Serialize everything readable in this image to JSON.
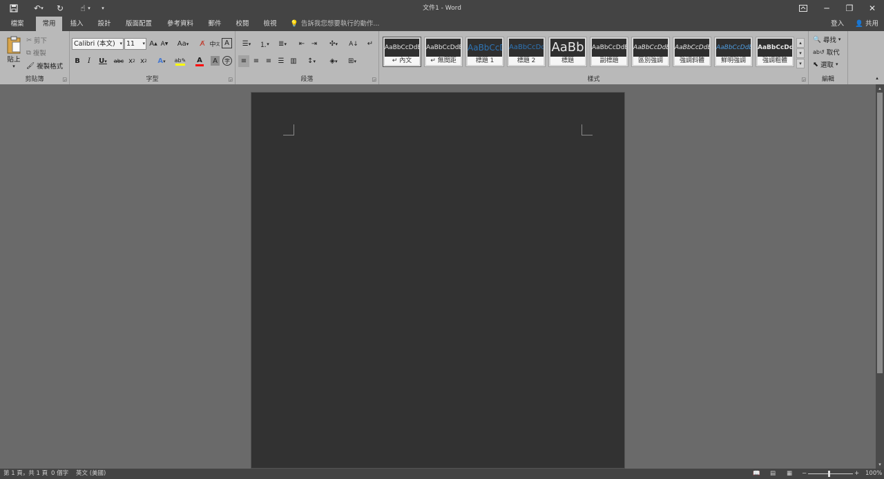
{
  "window": {
    "title": "文件1 - Word",
    "sign_in": "登入",
    "share": "共用"
  },
  "tabs": [
    {
      "label": "檔案"
    },
    {
      "label": "常用"
    },
    {
      "label": "插入"
    },
    {
      "label": "設計"
    },
    {
      "label": "版面配置"
    },
    {
      "label": "參考資料"
    },
    {
      "label": "郵件"
    },
    {
      "label": "校閱"
    },
    {
      "label": "檢視"
    }
  ],
  "active_tab": "常用",
  "tell_me": "告訴我您想要執行的動作...",
  "ribbon": {
    "clipboard": {
      "label": "剪貼簿",
      "paste": "貼上",
      "cut": "剪下",
      "copy": "複製",
      "format_painter": "複製格式"
    },
    "font": {
      "label": "字型",
      "font_name": "Calibri (本文)",
      "font_size": "11",
      "change_case": "Aa"
    },
    "paragraph": {
      "label": "段落"
    },
    "styles": {
      "label": "樣式",
      "items": [
        {
          "preview": "AaBbCcDdEe",
          "name": "內文",
          "color": "#e8e8e8"
        },
        {
          "preview": "AaBbCcDdEe",
          "name": "無間距",
          "color": "#e8e8e8"
        },
        {
          "preview": "AaBbCcD",
          "name": "標題 1",
          "color": "#2e74b5"
        },
        {
          "preview": "AaBbCcDdI",
          "name": "標題 2",
          "color": "#2e74b5"
        },
        {
          "preview": "AaBb",
          "name": "標題",
          "color": "#e8e8e8"
        },
        {
          "preview": "AaBbCcDdE",
          "name": "副標題",
          "color": "#e8e8e8"
        },
        {
          "preview": "AaBbCcDdEe",
          "name": "區別強調",
          "color": "#e8e8e8"
        },
        {
          "preview": "AaBbCcDdEe",
          "name": "強調斜體",
          "color": "#e8e8e8"
        },
        {
          "preview": "AaBbCcDdEe",
          "name": "鮮明強調",
          "color": "#4f9de0"
        },
        {
          "preview": "AaBbCcDdEe",
          "name": "強調粗體",
          "color": "#e8e8e8"
        }
      ]
    },
    "editing": {
      "label": "編輯",
      "find": "尋找",
      "replace": "取代",
      "select": "選取"
    }
  },
  "status": {
    "page": "第 1 頁，共 1 頁",
    "words": "0 個字",
    "language": "英文 (美國)",
    "zoom": "100%"
  },
  "colors": {
    "highlight": "#ffff00",
    "font_color": "#ff0000"
  }
}
